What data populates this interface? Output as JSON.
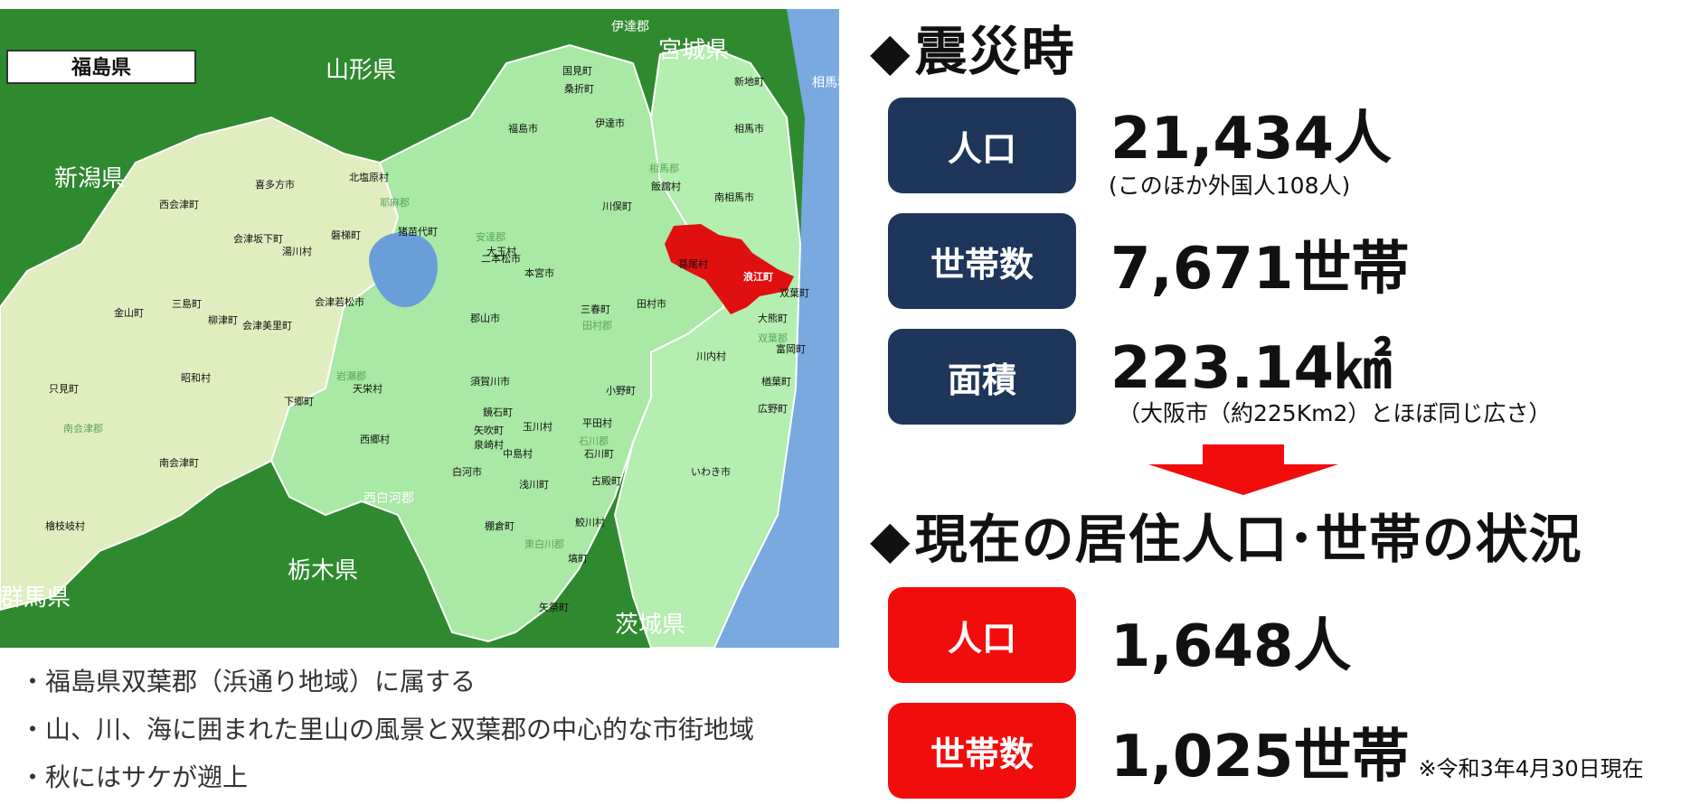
{
  "map": {
    "prefecture_label": "福島県",
    "neighbors": [
      "山形県",
      "宮城県",
      "新潟県",
      "栃木県",
      "茨城県",
      "群馬県"
    ],
    "side_note": "伊達郡",
    "side_note2": "西白河郡",
    "side_note3": "相馬郡",
    "places": [
      "国見町",
      "桑折町",
      "新地町",
      "福島市",
      "伊達市",
      "相馬市",
      "喜多方市",
      "北塩原村",
      "耶麻郡",
      "相馬郡",
      "飯舘村",
      "南相馬市",
      "西会津町",
      "会津坂下町",
      "湯川村",
      "磐梯町",
      "猪苗代町",
      "安達郡",
      "二本松市",
      "大玉村",
      "川俣町",
      "葛尾村",
      "浪江町",
      "双葉町",
      "本宮市",
      "三春町",
      "田村郡",
      "田村市",
      "大熊町",
      "双葉郡",
      "富岡町",
      "金山町",
      "三島町",
      "柳津町",
      "会津美里町",
      "会津若松市",
      "郡山市",
      "川内村",
      "楢葉町",
      "只見町",
      "昭和村",
      "岩瀬郡",
      "天栄村",
      "須賀川市",
      "小野町",
      "広野町",
      "南会津郡",
      "下郷町",
      "鏡石町",
      "玉川村",
      "平田村",
      "西郷村",
      "矢吹町",
      "泉崎村",
      "中島村",
      "石川町",
      "石川郡",
      "南会津町",
      "白河市",
      "浅川町",
      "古殿町",
      "いわき市",
      "檜枝岐村",
      "棚倉町",
      "鮫川村",
      "東白川郡",
      "塙町",
      "矢祭町"
    ],
    "highlight_color": "#e01010",
    "colors": {
      "other_prefecture": "#2f8a2f",
      "aizu": "#e0eebf",
      "nakadori": "#a9e8a5",
      "hamadori": "#b4eeb0",
      "sea": "#7aa9e0",
      "lake": "#6a9ed8"
    }
  },
  "bullets": [
    "・福島県双葉郡（浜通り地域）に属する",
    "・山、川、海に囲まれた里山の風景と双葉郡の中心的な市街地域",
    "・秋にはサケが遡上"
  ],
  "disaster": {
    "heading_mark": "◆",
    "heading": "震災時",
    "population_label": "人口",
    "population_value": "21,434人",
    "population_note": "(このほか外国人108人)",
    "households_label": "世帯数",
    "households_value": "7,671世帯",
    "area_label": "面積",
    "area_value": "223.14㎢",
    "area_note": "（大阪市（約225Km2）とほぼ同じ広さ）"
  },
  "current": {
    "heading_mark": "◆",
    "heading": "現在の居住人口･世帯の状況",
    "population_label": "人口",
    "population_value": "1,648人",
    "households_label": "世帯数",
    "households_value": "1,025世帯",
    "as_of": "※令和3年4月30日現在"
  },
  "colors": {
    "navy": "#1d365a",
    "red": "#f20d0d"
  }
}
